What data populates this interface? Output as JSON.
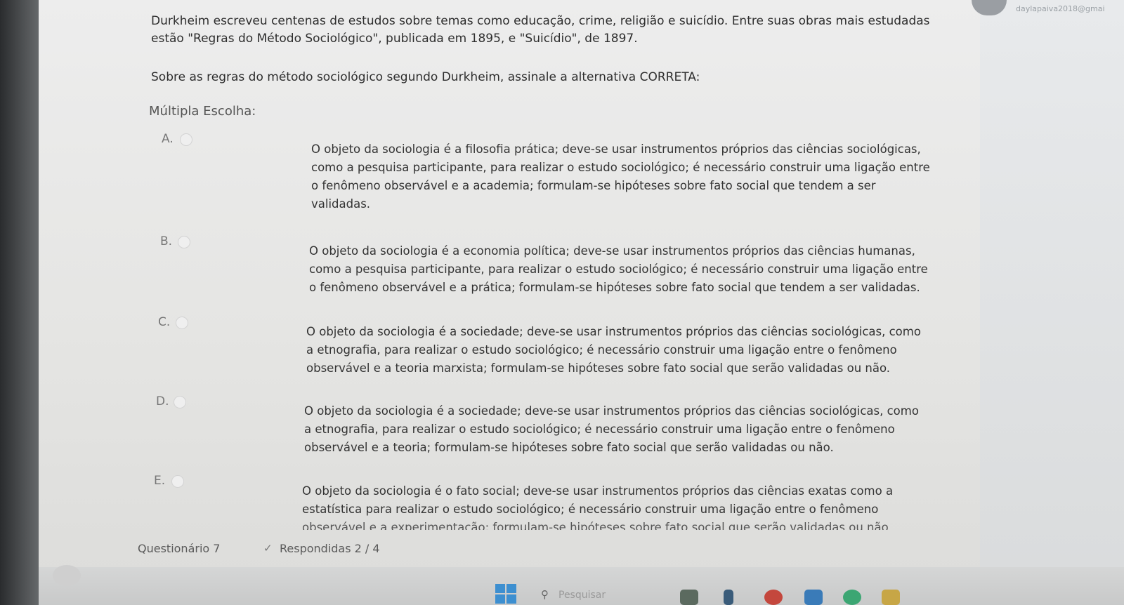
{
  "header": {
    "user_email": "daylapaiva2018@gmai"
  },
  "question": {
    "intro_line1": "Durkheim escreveu centenas de estudos sobre temas como educação, crime, religião e suicídio. Entre suas obras mais estudadas",
    "intro_line2": "estão \"Regras do Método Sociológico\", publicada em 1895, e \"Suicídio\", de 1897.",
    "prompt": "Sobre as regras do método sociológico segundo Durkheim, assinale a alternativa CORRETA:",
    "type_label": "Múltipla Escolha:"
  },
  "options": [
    {
      "letter": "A.",
      "lines": [
        "O objeto da sociologia é a filosofia prática; deve-se usar instrumentos próprios das ciências sociológicas,",
        "como a pesquisa participante, para realizar o estudo sociológico; é necessário construir uma ligação entre",
        "o fenômeno observável e a academia; formulam-se hipóteses sobre fato social que tendem a ser",
        "validadas."
      ]
    },
    {
      "letter": "B.",
      "lines": [
        "O objeto da sociologia é a economia política; deve-se usar instrumentos próprios das ciências humanas,",
        "como a pesquisa participante, para realizar o estudo sociológico; é necessário construir uma ligação entre",
        "o fenômeno observável e a prática; formulam-se hipóteses sobre fato social que tendem a ser validadas."
      ]
    },
    {
      "letter": "C.",
      "lines": [
        "O objeto da sociologia é a sociedade; deve-se usar instrumentos próprios das ciências sociológicas, como",
        "a etnografia, para realizar o estudo sociológico; é necessário construir uma ligação entre o fenômeno",
        "observável e a teoria marxista; formulam-se hipóteses sobre fato social que serão validadas ou não."
      ]
    },
    {
      "letter": "D.",
      "lines": [
        "O objeto da sociologia é a sociedade; deve-se usar instrumentos próprios das ciências sociológicas, como",
        "a etnografia, para realizar o estudo sociológico; é necessário construir uma ligação entre o fenômeno",
        "observável e a teoria; formulam-se hipóteses sobre fato social que serão validadas ou não."
      ]
    },
    {
      "letter": "E.",
      "lines": [
        "O objeto da sociologia é o fato social; deve-se usar instrumentos próprios das ciências exatas como a",
        "estatística para realizar o estudo sociológico; é necessário construir uma ligação entre o fenômeno",
        "observável e a experimentação; formulam-se hipóteses sobre fato social que serão validadas ou não"
      ]
    }
  ],
  "footer": {
    "quiz_name": "Questionário 7",
    "answered": "Respondidas 2 / 4"
  },
  "taskbar": {
    "search_placeholder": "Pesquisar"
  }
}
